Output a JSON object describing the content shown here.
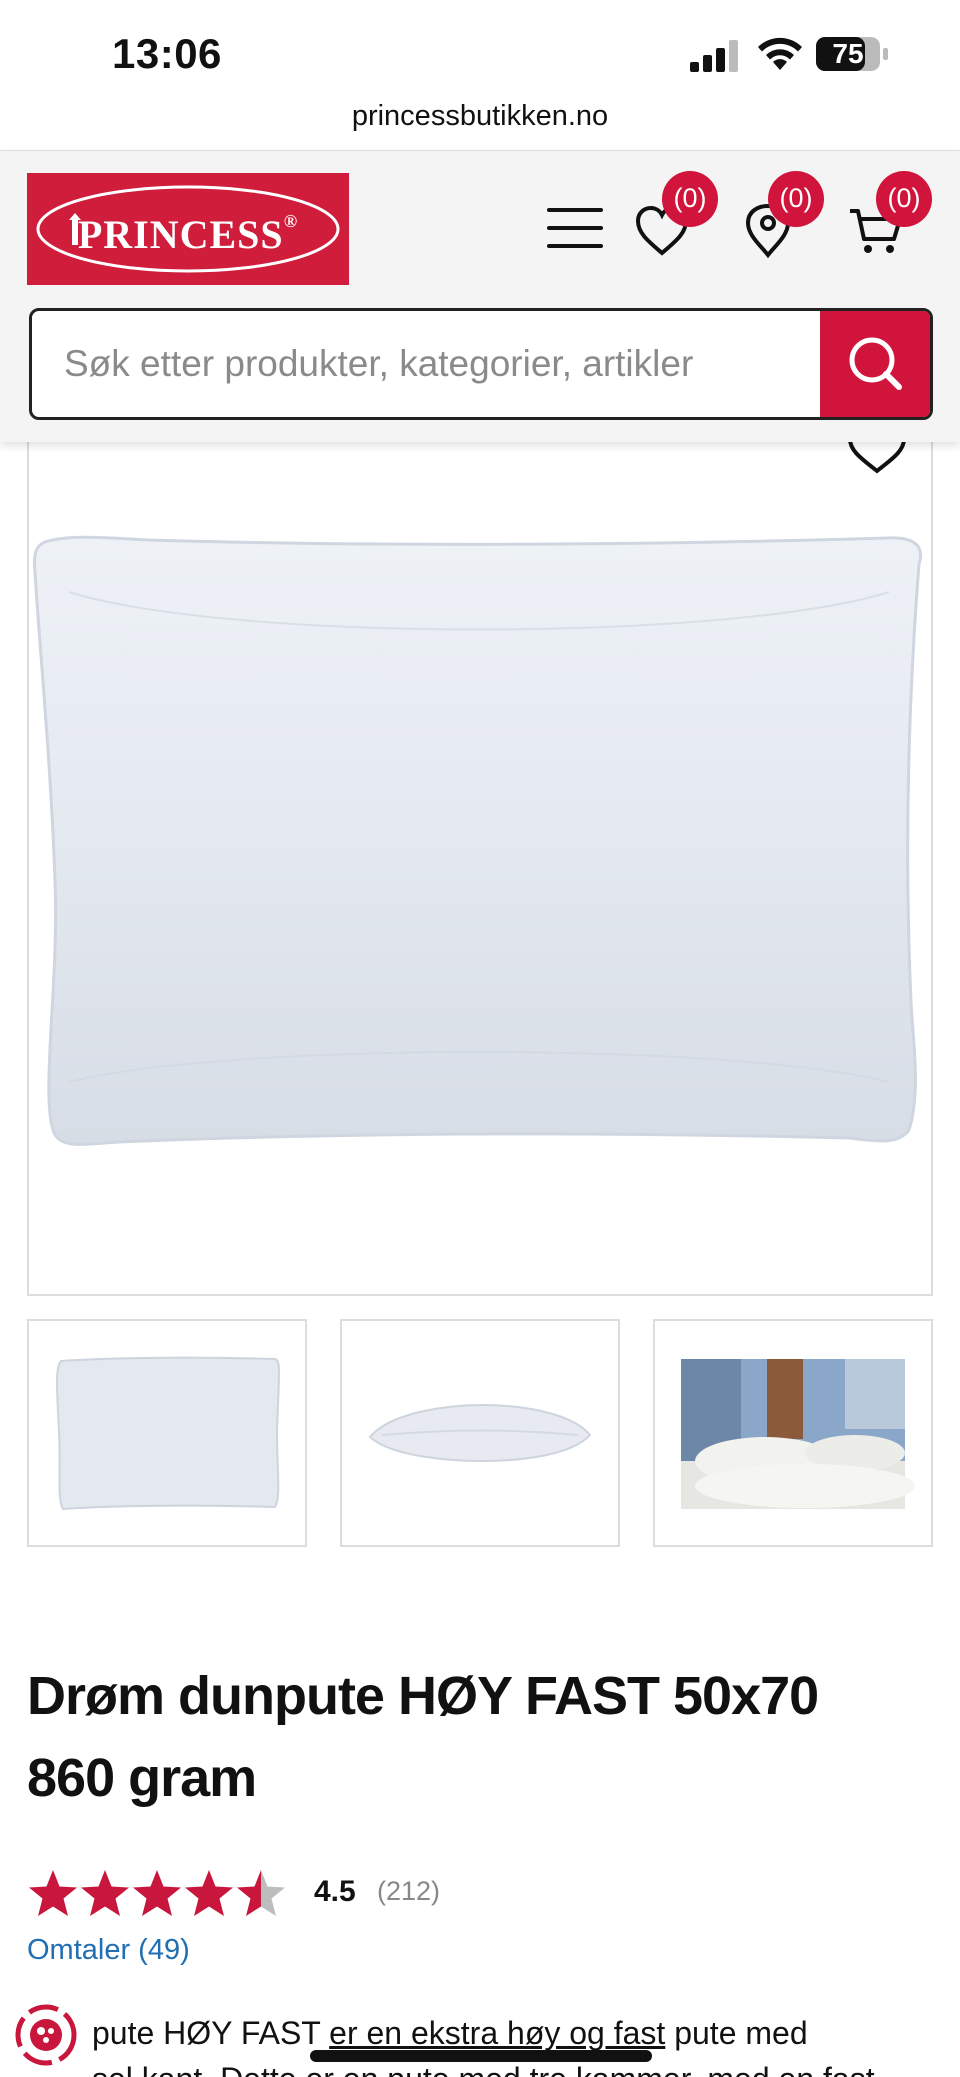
{
  "status_bar": {
    "time": "13:06",
    "battery_level": "75",
    "icons": [
      "signal-icon",
      "wifi-icon",
      "battery-icon"
    ]
  },
  "browser": {
    "url": "princessbutikken.no"
  },
  "header": {
    "logo_text": "PRINCESS",
    "logo_registered": "®",
    "wishlist_count": "(0)",
    "stores_count": "(0)",
    "cart_count": "(0)",
    "icons": [
      "menu-icon",
      "heart-icon",
      "location-pin-icon",
      "cart-icon"
    ],
    "accent_color": "#d0143c"
  },
  "search": {
    "placeholder": "Søk etter produkter, kategorier, artikler",
    "value": ""
  },
  "gallery": {
    "main_image": "pillow-product-image",
    "thumbnails": [
      "pillow-front-thumbnail",
      "pillow-side-thumbnail",
      "bedroom-lifestyle-thumbnail"
    ]
  },
  "product": {
    "title": "Drøm dunpute HØY FAST 50x70 860 gram",
    "rating_value": "4.5",
    "rating_fraction": 0.9,
    "rating_count": "(212)",
    "reviews_link": "Omtaler (49)",
    "description_start": "pute HØY FAST ",
    "description_link": "er en ekstra høy og fast",
    "description_end": " pute med",
    "description_line2": "sel kant. Dette er en pute med tre kammer, med en fast"
  }
}
